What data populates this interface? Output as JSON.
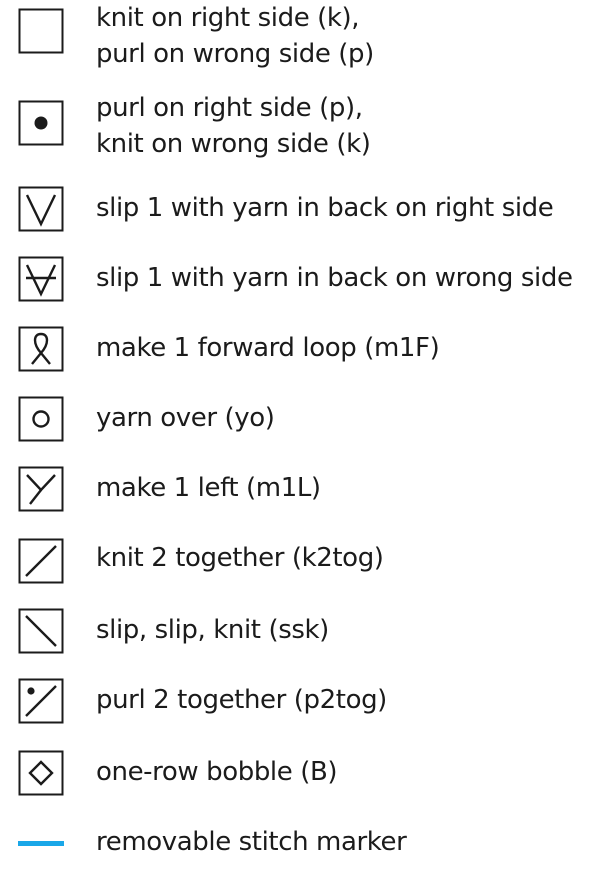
{
  "legend": {
    "entries": [
      {
        "symbol": "empty-square-icon",
        "lines": [
          "knit on right side (k),",
          "purl on wrong side (p)"
        ]
      },
      {
        "symbol": "dot-icon",
        "lines": [
          "purl on right side (p),",
          "knit on wrong side (k)"
        ]
      },
      {
        "symbol": "v-icon",
        "lines": [
          "slip 1 with yarn in back on right side"
        ]
      },
      {
        "symbol": "v-with-bar-icon",
        "lines": [
          "slip 1 with yarn in back on wrong side"
        ]
      },
      {
        "symbol": "forward-loop-icon",
        "lines": [
          "make 1 forward loop (m1F)"
        ]
      },
      {
        "symbol": "circle-icon",
        "lines": [
          "yarn over (yo)"
        ]
      },
      {
        "symbol": "y-icon",
        "lines": [
          "make 1 left (m1L)"
        ]
      },
      {
        "symbol": "forward-slash-icon",
        "lines": [
          "knit 2 together (k2tog)"
        ]
      },
      {
        "symbol": "back-slash-icon",
        "lines": [
          "slip, slip, knit (ssk)"
        ]
      },
      {
        "symbol": "slash-with-dot-icon",
        "lines": [
          "purl 2 together (p2tog)"
        ]
      },
      {
        "symbol": "diamond-icon",
        "lines": [
          "one-row bobble (B)"
        ]
      },
      {
        "symbol": "blue-dash-icon",
        "lines": [
          "removable stitch marker"
        ]
      }
    ]
  },
  "colors": {
    "text": "#1b1b1b",
    "stroke": "#1b1b1b",
    "marker": "#1aa7e8"
  }
}
